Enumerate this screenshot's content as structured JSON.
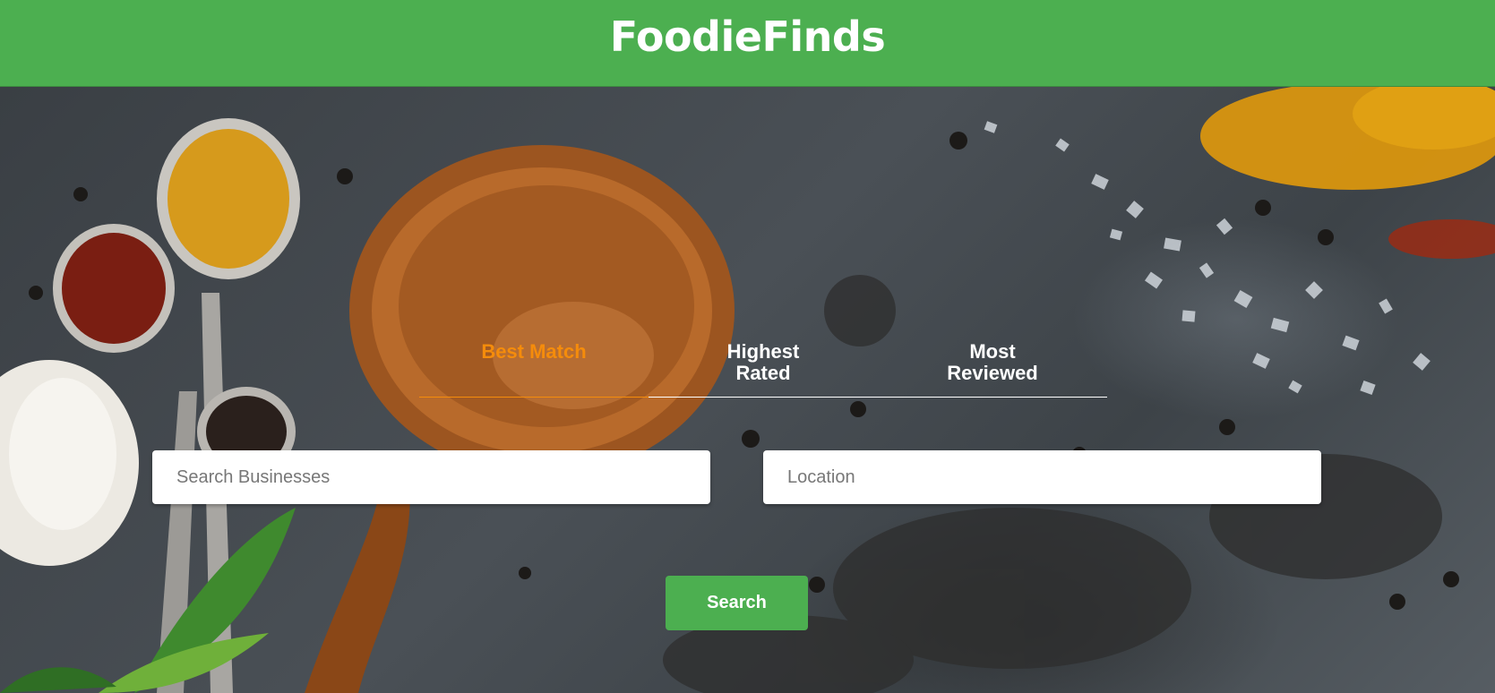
{
  "header": {
    "title": "FoodieFinds"
  },
  "sort_tabs": [
    {
      "label": "Best Match",
      "active": true
    },
    {
      "label": "Highest Rated",
      "active": false
    },
    {
      "label": "Most Reviewed",
      "active": false
    }
  ],
  "search": {
    "business_placeholder": "Search Businesses",
    "business_value": "",
    "location_placeholder": "Location",
    "location_value": "",
    "button_label": "Search"
  },
  "colors": {
    "header_bg": "#4caf50",
    "active_tab": "#f58c0b",
    "button_bg": "#4caf50"
  }
}
